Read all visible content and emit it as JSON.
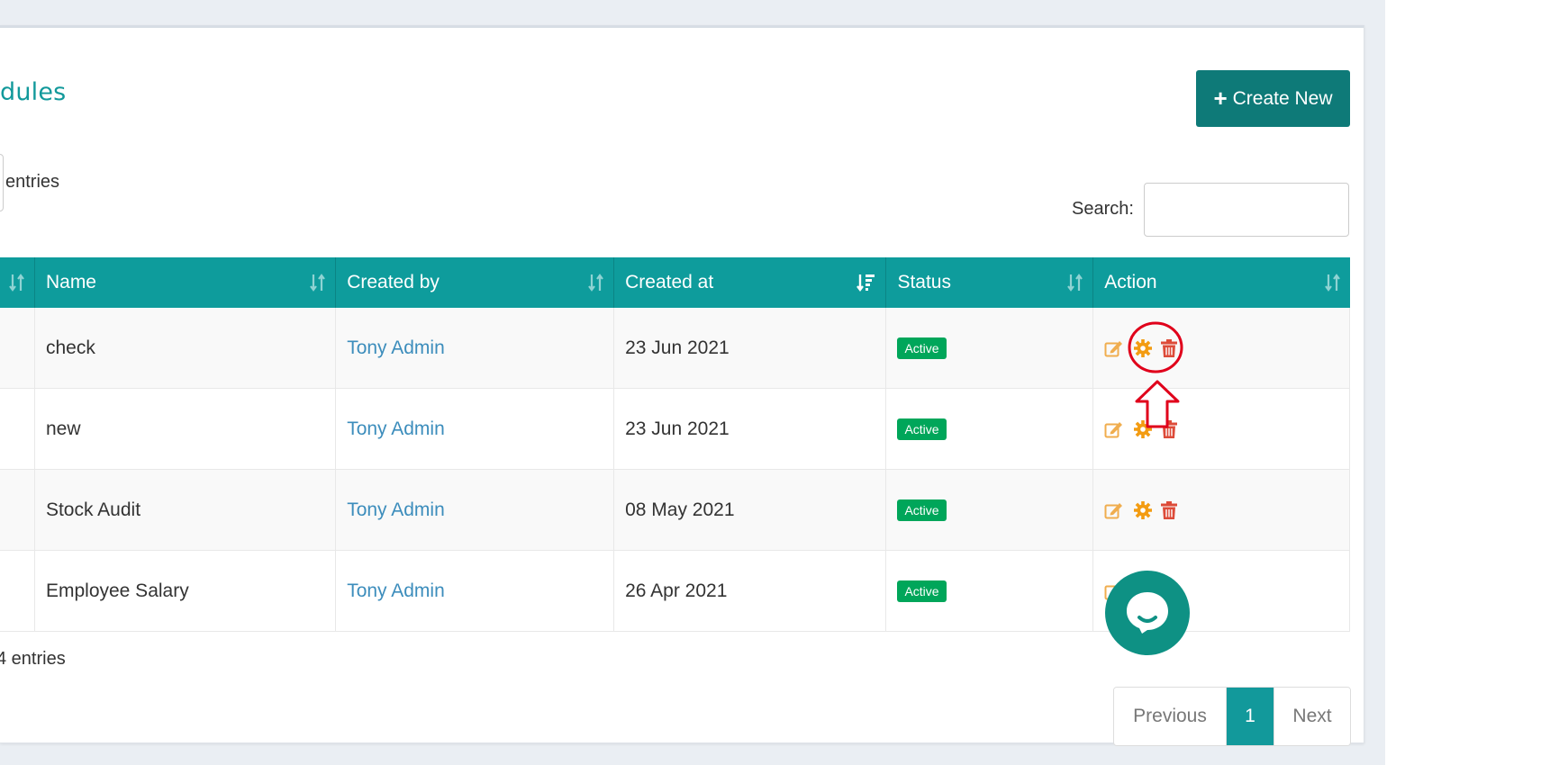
{
  "page": {
    "title": "dules",
    "create_button": "Create New"
  },
  "controls": {
    "length_suffix": "entries",
    "search_label": "Search:",
    "search_value": ""
  },
  "table": {
    "columns": [
      "Name",
      "Created by",
      "Created at",
      "Status",
      "Action"
    ],
    "rows": [
      {
        "name": "check",
        "created_by": "Tony Admin",
        "created_at": "23 Jun 2021",
        "status": "Active"
      },
      {
        "name": "new",
        "created_by": "Tony Admin",
        "created_at": "23 Jun 2021",
        "status": "Active"
      },
      {
        "name": "Stock Audit",
        "created_by": "Tony Admin",
        "created_at": "08 May 2021",
        "status": "Active"
      },
      {
        "name": "Employee Salary",
        "created_by": "Tony Admin",
        "created_at": "26 Apr 2021",
        "status": "Active"
      }
    ]
  },
  "footer": {
    "info": "4 entries",
    "pagination": {
      "previous": "Previous",
      "current": "1",
      "next": "Next"
    }
  },
  "colors": {
    "primary": "#12999b",
    "header_bg": "#0e9c9c",
    "button_bg": "#0e7a78",
    "success": "#00a65a",
    "link": "#3c8dbc",
    "edit_icon": "#f0ad4e",
    "settings_icon": "#f39c12",
    "delete_icon": "#dd4b39",
    "annotation": "#e0001b"
  },
  "icons": {
    "sort": "sort-icon",
    "sort_active": "sort-desc-icon",
    "edit": "edit-icon",
    "settings": "gear-icon",
    "delete": "trash-icon",
    "chat": "chat-icon",
    "create": "plus-icon"
  }
}
